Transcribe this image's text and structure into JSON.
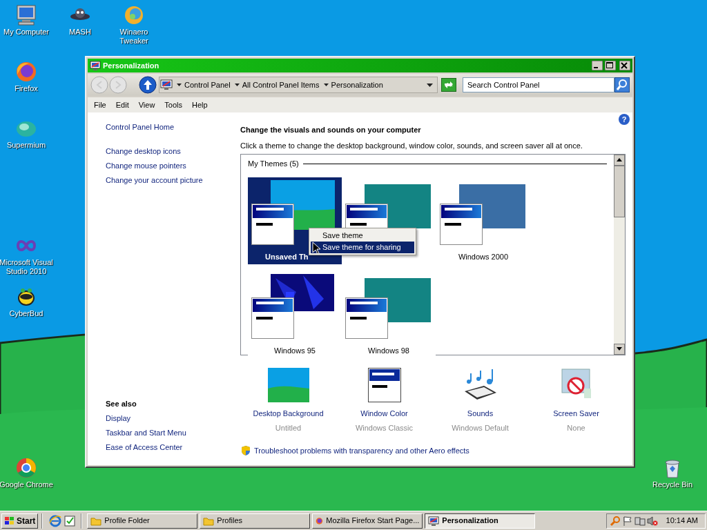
{
  "desktop_icons": [
    {
      "label": "My Computer",
      "kind": "computer"
    },
    {
      "label": "MASH",
      "kind": "ufo"
    },
    {
      "label": "Winaero Tweaker",
      "kind": "swirl"
    },
    {
      "label": "Firefox",
      "kind": "fox"
    },
    {
      "label": "Supermium",
      "kind": "orb"
    },
    {
      "label": "Microsoft Visual Studio 2010",
      "kind": "infinity"
    },
    {
      "label": "CyberBud",
      "kind": "bug"
    },
    {
      "label": "Google Chrome",
      "kind": "ring"
    },
    {
      "label": "Recycle Bin",
      "kind": "bin"
    }
  ],
  "window": {
    "title": "Personalization"
  },
  "address_bar": {
    "breadcrumb": [
      "Control Panel",
      "All Control Panel Items",
      "Personalization"
    ],
    "search": {
      "placeholder": "Search Control Panel"
    }
  },
  "menu_bar": [
    "File",
    "Edit",
    "View",
    "Tools",
    "Help"
  ],
  "help": "?",
  "sidebar": {
    "links": [
      {
        "label": "Control Panel Home"
      },
      {
        "label": "Change desktop icons"
      },
      {
        "label": "Change mouse pointers"
      },
      {
        "label": "Change your account picture"
      }
    ],
    "see_also": {
      "heading": "See also",
      "links": [
        "Display",
        "Taskbar and Start Menu",
        "Ease of Access Center"
      ]
    }
  },
  "heading": "Change the visuals and sounds on your computer",
  "description": "Click a theme to change the desktop background, window color, sounds, and screen saver all at once.",
  "themes": {
    "group": "My Themes (5)",
    "items": [
      {
        "label": "Unsaved Th",
        "selected": true,
        "kind": "landscape"
      },
      {
        "selected": false,
        "kind": "solid",
        "color": "#138483"
      },
      {
        "label": "Windows 2000",
        "selected": false,
        "kind": "solid",
        "color": "#3a6ea5"
      },
      {
        "label": "Windows 95",
        "selected": false,
        "kind": "pattern"
      },
      {
        "label": "Windows 98",
        "selected": false,
        "kind": "solid",
        "color": "#138483"
      }
    ]
  },
  "context_menu": [
    {
      "label": "Save theme",
      "selected": false
    },
    {
      "label": "Save theme for sharing",
      "selected": true
    }
  ],
  "settings": [
    {
      "label": "Desktop Background",
      "value": "Untitled",
      "kind": "background"
    },
    {
      "label": "Window Color",
      "value": "Windows Classic",
      "kind": "window"
    },
    {
      "label": "Sounds",
      "value": "Windows Default",
      "kind": "sounds"
    },
    {
      "label": "Screen Saver",
      "value": "None",
      "kind": "screensaver"
    }
  ],
  "troubleshoot_link": "Troubleshoot problems with transparency and other Aero effects",
  "taskbar": {
    "start": "Start",
    "tasks": [
      {
        "label": "Profile Folder",
        "selected": false,
        "kind": "folder"
      },
      {
        "label": "Profiles",
        "selected": false,
        "kind": "folder"
      },
      {
        "label": "Mozilla Firefox Start Page...",
        "selected": false,
        "kind": "fox"
      },
      {
        "label": "Personalization",
        "selected": true,
        "kind": "monitor"
      }
    ],
    "clock": "10:14 AM"
  }
}
